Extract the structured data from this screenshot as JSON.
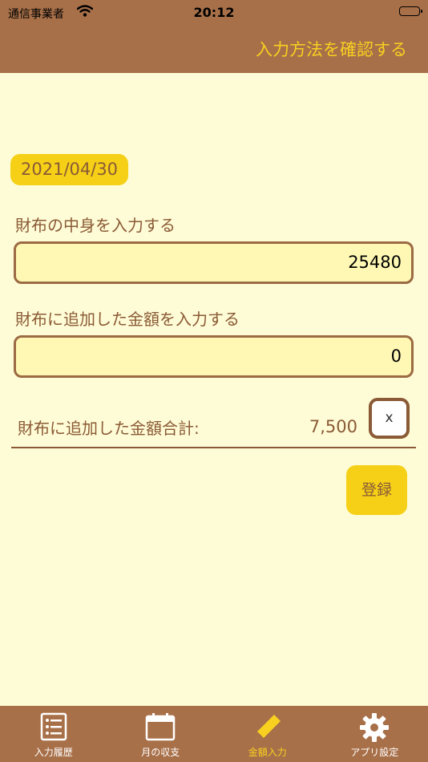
{
  "status_bar": {
    "carrier": "通信事業者",
    "time": "20:12"
  },
  "header": {
    "howto_link": "入力方法を確認する"
  },
  "date": "2021/04/30",
  "wallet": {
    "label": "財布の中身を入力する",
    "value": "25480"
  },
  "added": {
    "label": "財布に追加した金額を入力する",
    "value": "0"
  },
  "total": {
    "label": "財布に追加した金額合計:",
    "value": "7,500",
    "clear_label": "x"
  },
  "register_label": "登録",
  "tabs": [
    {
      "label": "入力履歴",
      "icon": "list-icon",
      "active": false
    },
    {
      "label": "月の収支",
      "icon": "calendar-icon",
      "active": false
    },
    {
      "label": "金額入力",
      "icon": "pencil-icon",
      "active": true
    },
    {
      "label": "アプリ設定",
      "icon": "gear-icon",
      "active": false
    }
  ],
  "colors": {
    "header_bg": "#A87049",
    "background": "#FEFCD6",
    "accent_yellow": "#F5D016",
    "text_brown": "#8A5A36",
    "field_bg": "#FEF8B4"
  }
}
